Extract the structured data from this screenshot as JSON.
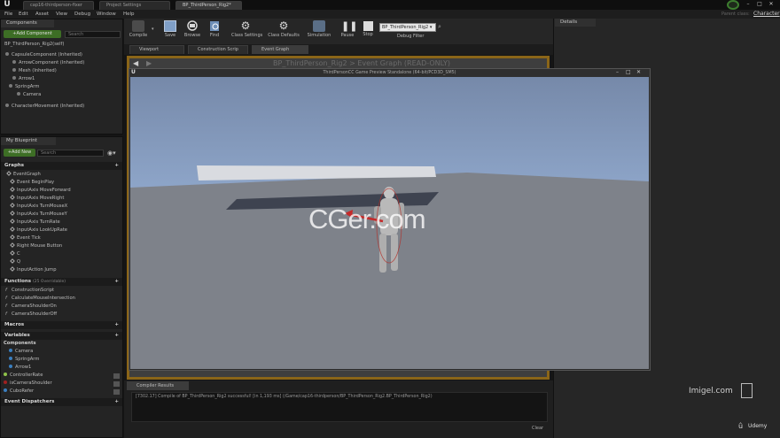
{
  "titlebar": {
    "tabs": [
      "cap16-thirdperson-fixer",
      "Project Settings",
      "BP_ThirdPerson_Rig2*"
    ]
  },
  "menubar": {
    "items": [
      "File",
      "Edit",
      "Asset",
      "View",
      "Debug",
      "Window",
      "Help"
    ],
    "right_label": "Character",
    "parent_class": "Parent class:"
  },
  "components_panel": {
    "title": "Components",
    "add_button": "+Add Component",
    "search_placeholder": "Search",
    "self_item": "BP_ThirdPerson_Rig2(self)",
    "tree": [
      "CapsuleComponent (Inherited)",
      "ArrowComponent (Inherited)",
      "Mesh (Inherited)",
      "Arrow1",
      "SpringArm",
      "Camera",
      "CharacterMovement (Inherited)"
    ]
  },
  "myblueprint_panel": {
    "title": "My Blueprint",
    "add_button": "+Add New",
    "search_placeholder": "Search",
    "graphs_label": "Graphs",
    "event_graph": "EventGraph",
    "events": [
      "Event BeginPlay",
      "InputAxis MoveForward",
      "InputAxis MoveRight",
      "InputAxis TurnMouseX",
      "InputAxis TurnMouseY",
      "InputAxis TurnRate",
      "InputAxis LookUpRate",
      "Event Tick",
      "Right Mouse Button",
      "C",
      "Q",
      "InputAction Jump"
    ],
    "functions_label": "Functions",
    "functions_overridable": "(25 Overridable)",
    "functions": [
      "ConstructionScript",
      "CalculateMouseIntersection",
      "CameraShoulderOn",
      "CameraShoulderOff"
    ],
    "macros_label": "Macros",
    "variables_label": "Variables",
    "components_label": "Components",
    "variables": [
      "Camera",
      "SpringArm",
      "Arrow1",
      "ControllerRate",
      "isCameraShoulder",
      "CuboRefer"
    ],
    "event_dispatchers_label": "Event Dispatchers"
  },
  "toolbar": {
    "buttons": [
      {
        "label": "Compile",
        "icon": "compile-icon"
      },
      {
        "label": "Save",
        "icon": "save-icon"
      },
      {
        "label": "Browse",
        "icon": "browse-icon"
      },
      {
        "label": "Find",
        "icon": "find-icon"
      },
      {
        "label": "Class Settings",
        "icon": "gear-icon"
      },
      {
        "label": "Class Defaults",
        "icon": "defaults-icon"
      },
      {
        "label": "Simulation",
        "icon": "simulation-icon"
      },
      {
        "label": "Pause",
        "icon": "pause-icon"
      },
      {
        "label": "Stop",
        "icon": "stop-icon"
      }
    ],
    "debug_select_value": "BP_ThirdPerson_Rig2",
    "debug_filter_label": "Debug Filter"
  },
  "graph_tabs": [
    "Viewport",
    "Construction Scrip",
    "Event Graph"
  ],
  "graph_header": {
    "title": "BP_ThirdPerson_Rig2 > Event Graph",
    "readonly": "(READ-ONLY)"
  },
  "details_panel": {
    "title": "Details"
  },
  "game_window": {
    "title": "ThirdPersonCC Game Preview Standalone (64-bit/PCD3D_SM5)"
  },
  "compiler_results": {
    "tab_label": "Compiler Results",
    "log_line": "[7302.17] Compile of BP_ThirdPerson_Rig2 successful! [in 1,193 ms] (/Game/cap16-thirdperson/BP_ThirdPerson_Rig2.BP_ThirdPerson_Rig2)",
    "clear_label": "Clear"
  },
  "watermarks": {
    "center": "CGer.com",
    "imigel": "Imigel.com",
    "udemy": "Udemy"
  },
  "colors": {
    "sky": "#7d94b8",
    "ground": "#7d8189",
    "accent_green": "#3d6e25",
    "graph_border": "#8a6518"
  }
}
